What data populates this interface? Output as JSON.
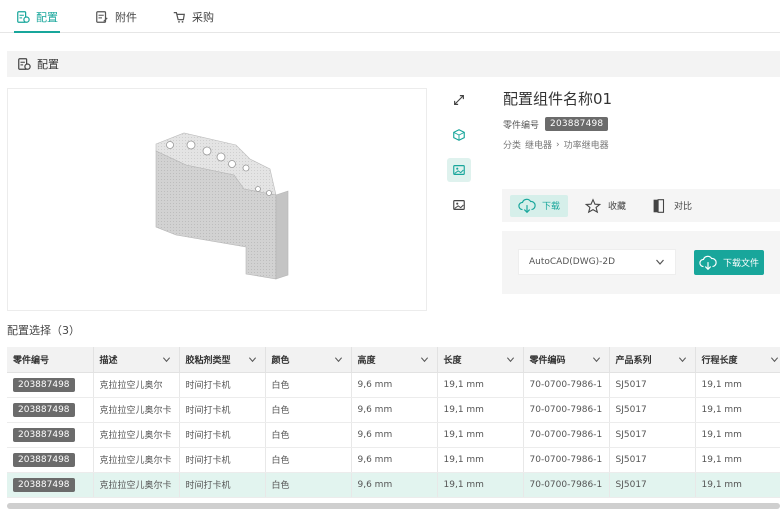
{
  "tabs": [
    {
      "label": "配置",
      "icon": "config-icon",
      "active": true
    },
    {
      "label": "附件",
      "icon": "attachment-icon",
      "active": false
    },
    {
      "label": "采购",
      "icon": "purchase-icon",
      "active": false
    }
  ],
  "section": {
    "title": "配置"
  },
  "product": {
    "title": "配置组件名称01",
    "part_label": "零件编号",
    "part_number": "203887498",
    "category_label": "分类",
    "category_1": "继电器",
    "category_2": "功率继电器"
  },
  "actions": {
    "download": "下载",
    "favorite": "收藏",
    "compare": "对比"
  },
  "download_box": {
    "format": "AutoCAD(DWG)-2D",
    "button": "下载文件"
  },
  "config_select": {
    "title": "配置选择（3）"
  },
  "table": {
    "headers": [
      "零件编号",
      "描述",
      "胶粘剂类型",
      "颜色",
      "高度",
      "长度",
      "零件编码",
      "产品系列",
      "行程长度"
    ],
    "rows": [
      [
        "203887498",
        "克拉拉空儿奥尔",
        "时间打卡机",
        "白色",
        "9,6 mm",
        "19,1 mm",
        "70-0700-7986-1",
        "SJ5017",
        "19,1 mm"
      ],
      [
        "203887498",
        "克拉拉空儿奥尔卡",
        "时间打卡机",
        "白色",
        "9,6 mm",
        "19,1 mm",
        "70-0700-7986-1",
        "SJ5017",
        "19,1 mm"
      ],
      [
        "203887498",
        "克拉拉空儿奥尔卡",
        "时间打卡机",
        "白色",
        "9,6 mm",
        "19,1 mm",
        "70-0700-7986-1",
        "SJ5017",
        "19,1 mm"
      ],
      [
        "203887498",
        "克拉拉空儿奥尔卡",
        "时间打卡机",
        "白色",
        "9,6 mm",
        "19,1 mm",
        "70-0700-7986-1",
        "SJ5017",
        "19,1 mm"
      ],
      [
        "203887498",
        "克拉拉空儿奥尔卡",
        "时间打卡机",
        "白色",
        "9,6 mm",
        "19,1 mm",
        "70-0700-7986-1",
        "SJ5017",
        "19,1 mm"
      ]
    ],
    "highlighted_row": 4
  },
  "colors": {
    "accent": "#18a69b",
    "accent_light": "#d6efea",
    "pill": "#6b6b6b"
  },
  "tools": [
    "expand-icon",
    "3d-view-icon",
    "image-view-icon",
    "image-icon"
  ]
}
